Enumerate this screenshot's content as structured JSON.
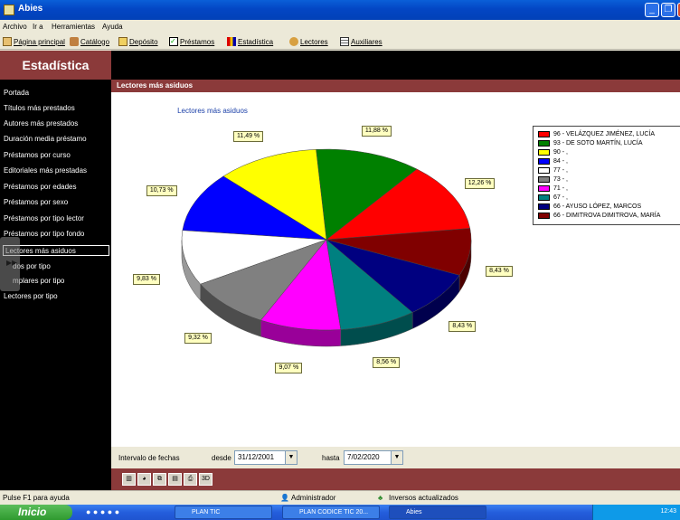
{
  "window": {
    "title": "Abies"
  },
  "menu": [
    "Archivo",
    "Ir a",
    "Herramientas",
    "Ayuda"
  ],
  "toolbar": [
    {
      "label": "Página principal",
      "icon": "home-icon"
    },
    {
      "label": "Catálogo",
      "icon": "books-icon"
    },
    {
      "label": "Depósito",
      "icon": "box-icon"
    },
    {
      "label": "Préstamos",
      "icon": "checkbox-icon"
    },
    {
      "label": "Estadística",
      "icon": "bar-chart-icon"
    },
    {
      "label": "Lectores",
      "icon": "readers-icon"
    },
    {
      "label": "Auxiliares",
      "icon": "table-icon"
    }
  ],
  "sidebar": {
    "title": "Estadística",
    "items": [
      "Portada",
      "Títulos más prestados",
      "Autores más prestados",
      "Duración media préstamo",
      "Préstamos por curso",
      "Editoriales más prestadas",
      "Préstamos por edades",
      "Préstamos por sexo",
      "Préstamos por tipo lector",
      "Préstamos por tipo fondo",
      "Lectores más asiduos",
      "dos por tipo",
      "mplares por tipo",
      "Lectores por tipo"
    ],
    "selected_index": 10
  },
  "main": {
    "header": "Lectores más asiduos",
    "date_interval_label": "Intervalo de fechas",
    "desde_label": "desde",
    "desde_value": "31/12/2001",
    "hasta_label": "hasta",
    "hasta_value": "7/02/2020"
  },
  "chart_data": {
    "type": "pie",
    "title": "Lectores más asiduos",
    "style": "3d",
    "slices": [
      {
        "legend": "96 - VELÁZQUEZ JIMÉNEZ, LUCÍA",
        "label": "12,26 %",
        "value": 12.26,
        "color": "#ff0000"
      },
      {
        "legend": "93 - DE SOTO MARTÍN, LUCÍA",
        "label": "11,88 %",
        "value": 11.88,
        "color": "#008000"
      },
      {
        "legend": "90 - ,",
        "label": "11,49 %",
        "value": 11.49,
        "color": "#ffff00"
      },
      {
        "legend": "84 - ,",
        "label": "10,73 %",
        "value": 10.73,
        "color": "#0000ff"
      },
      {
        "legend": "77 - ,",
        "label": "9,83 %",
        "value": 9.83,
        "color": "#ffffff"
      },
      {
        "legend": "73 - ,",
        "label": "9,32 %",
        "value": 9.32,
        "color": "#808080"
      },
      {
        "legend": "71 - ,",
        "label": "9,07 %",
        "value": 9.07,
        "color": "#ff00ff"
      },
      {
        "legend": "67 - ,",
        "label": "8,56 %",
        "value": 8.56,
        "color": "#008080"
      },
      {
        "legend": "66 - AYUSO LÓPEZ, MARCOS",
        "label": "8,43 %",
        "value": 8.43,
        "color": "#000080"
      },
      {
        "legend": "66 - DIMITROVA DIMITROVA, MARÍA",
        "label": "8,43 %",
        "value": 8.43,
        "color": "#800000"
      }
    ],
    "legend_placement": "right"
  },
  "status": {
    "help": "Pulse F1 para ayuda",
    "user": "Administrador",
    "inversos": "Inversos actualizados"
  },
  "taskbar": {
    "start": "Inicio",
    "tasks": [
      "PLAN TIC",
      "PLAN CODICE TIC 20...",
      "Abies"
    ],
    "clock": "12:43"
  }
}
